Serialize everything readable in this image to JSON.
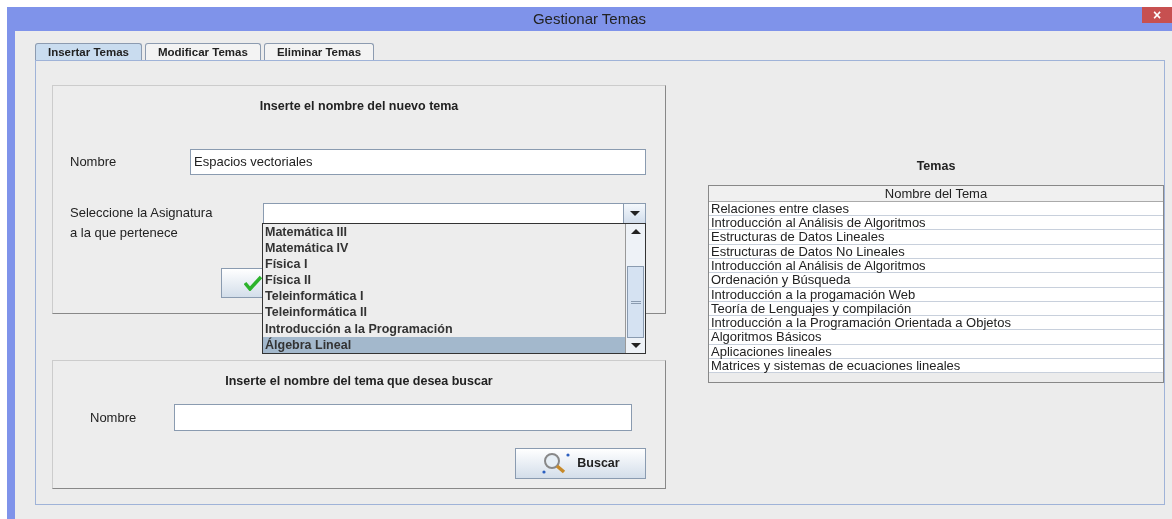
{
  "window": {
    "title": "Gestionar Temas",
    "close": "×"
  },
  "tabs": [
    {
      "label": "Insertar Temas",
      "selected": true
    },
    {
      "label": "Modificar Temas",
      "selected": false
    },
    {
      "label": "Eliminar Temas",
      "selected": false
    }
  ],
  "insert_panel": {
    "heading": "Inserte el nombre del nuevo tema",
    "name_label": "Nombre",
    "name_value": "Espacios vectoriales",
    "subject_label_lines": [
      "Seleccione la Asignatura",
      "a la que pertenece"
    ],
    "subject_options": [
      {
        "label": "Matemática III",
        "selected": false
      },
      {
        "label": "Matemática IV",
        "selected": false
      },
      {
        "label": "Física I",
        "selected": false
      },
      {
        "label": "Física II",
        "selected": false
      },
      {
        "label": "Teleinformática I",
        "selected": false
      },
      {
        "label": "Teleinformática II",
        "selected": false
      },
      {
        "label": "Introducción a la Programación",
        "selected": false
      },
      {
        "label": "Álgebra Lineal",
        "selected": true
      }
    ]
  },
  "search_panel": {
    "heading": "Inserte el nombre del tema que desea buscar",
    "name_label": "Nombre",
    "search_button": "Buscar"
  },
  "topics": {
    "title": "Temas",
    "columns": [
      "Nombre del Tema"
    ],
    "rows": [
      "Relaciones entre clases",
      "Introducción al Análisis de Algoritmos",
      "Estructuras de Datos Lineales",
      "Estructuras de Datos No Lineales",
      "Introducción al Análisis de Algoritmos",
      "Ordenación y Búsqueda",
      "Introducción a la progamación Web",
      "Teoría de Lenguajes y compilación",
      "Introducción a la Programación Orientada a Objetos",
      "Algoritmos Básicos",
      "Aplicaciones lineales",
      "Matrices y sistemas de ecuaciones lineales"
    ]
  }
}
